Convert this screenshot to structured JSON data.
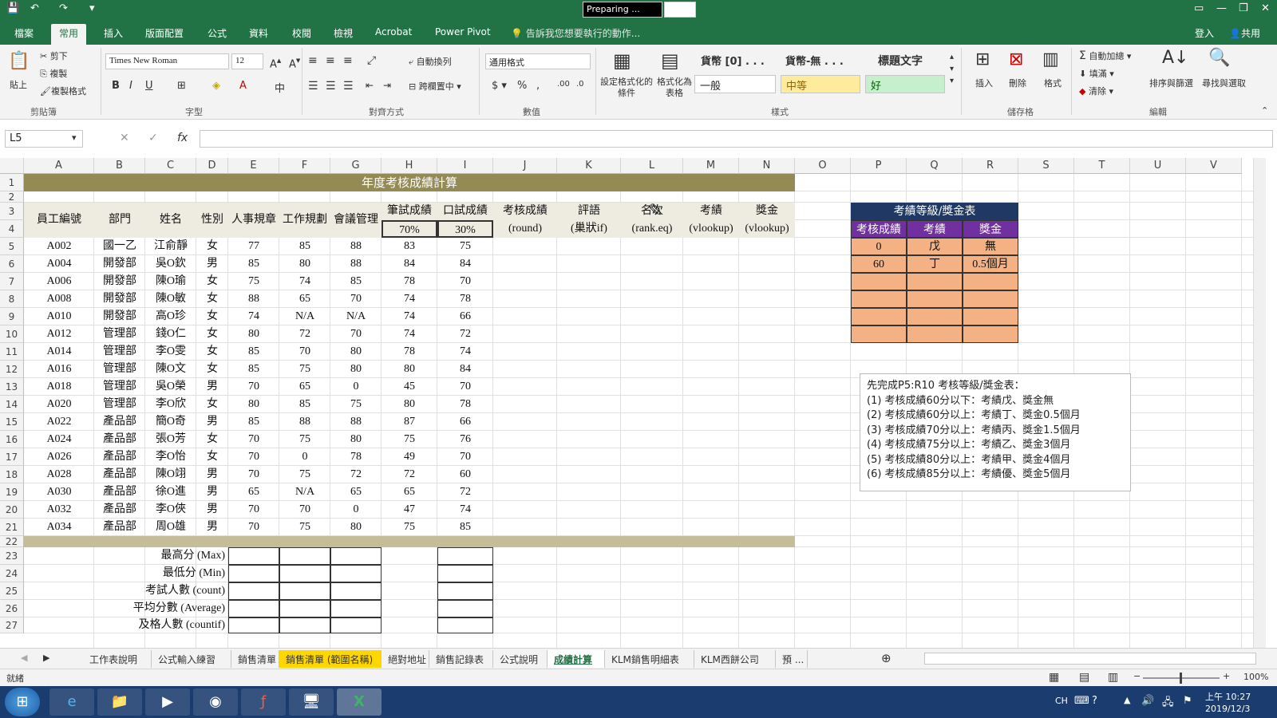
{
  "titlebar": {
    "preparing": "Preparing ..."
  },
  "ribbon_tabs": [
    "檔案",
    "常用",
    "插入",
    "版面配置",
    "公式",
    "資料",
    "校閱",
    "檢視",
    "Acrobat",
    "Power Pivot"
  ],
  "tell_me": "告訴我您想要執行的動作...",
  "account": {
    "login": "登入",
    "share": "共用"
  },
  "ribbon": {
    "cut": "剪下",
    "copy": "複製",
    "paste": "貼上",
    "format_painter": "複製格式",
    "clipboard": "剪貼簿",
    "font_name": "Times New Roman",
    "font_size": "12",
    "font_group": "字型",
    "wrap": "自動換列",
    "merge": "跨欄置中",
    "align_group": "對齊方式",
    "number_format": "通用格式",
    "number_group": "數值",
    "cond_format": "設定格式化的條件",
    "format_table": "格式化為表格",
    "styles": [
      "貨幣 [0] . . .",
      "貨幣-無 . . .",
      "標題文字",
      "一般",
      "中等",
      "好"
    ],
    "styles_group": "樣式",
    "insert": "插入",
    "delete": "刪除",
    "format": "格式",
    "cells_group": "儲存格",
    "autosum": "自動加總",
    "fill": "填滿",
    "clear": "清除",
    "sort": "排序與篩選",
    "find": "尋找與選取",
    "edit_group": "編輯"
  },
  "namebox": "L5",
  "columns": [
    "A",
    "B",
    "C",
    "D",
    "E",
    "F",
    "G",
    "H",
    "I",
    "J",
    "K",
    "L",
    "M",
    "N",
    "O",
    "P",
    "Q",
    "R",
    "S",
    "T",
    "U",
    "V"
  ],
  "rows": [
    "1",
    "2",
    "3",
    "4",
    "5",
    "6",
    "7",
    "8",
    "9",
    "10",
    "11",
    "12",
    "13",
    "14",
    "15",
    "16",
    "17",
    "18",
    "19",
    "20",
    "21",
    "22",
    "23",
    "24",
    "25",
    "26",
    "27"
  ],
  "sheet_title": "年度考核成績計算",
  "headers": {
    "emp": "員工編號",
    "dept": "部門",
    "name": "姓名",
    "gender": "性別",
    "e": "人事規章",
    "f": "工作規劃",
    "g": "會議管理",
    "h": "筆試成績",
    "i": "口試成績",
    "h_pct": "70%",
    "i_pct": "30%",
    "j": "考核成績",
    "j2": "(round)",
    "k": "評語",
    "k2": "(巢狀if)",
    "l": "名次",
    "l2": "(rank.eq)",
    "m": "考績",
    "m2": "(vlookup)",
    "n": "獎金",
    "n2": "(vlookup)"
  },
  "employees": [
    [
      "A002",
      "國一乙",
      "江俞靜",
      "女",
      "77",
      "85",
      "88",
      "83",
      "75"
    ],
    [
      "A004",
      "開發部",
      "吳O欽",
      "男",
      "85",
      "80",
      "88",
      "84",
      "84"
    ],
    [
      "A006",
      "開發部",
      "陳O瑜",
      "女",
      "75",
      "74",
      "85",
      "78",
      "70"
    ],
    [
      "A008",
      "開發部",
      "陳O敏",
      "女",
      "88",
      "65",
      "70",
      "74",
      "78"
    ],
    [
      "A010",
      "開發部",
      "高O珍",
      "女",
      "74",
      "N/A",
      "N/A",
      "74",
      "66"
    ],
    [
      "A012",
      "管理部",
      "錢O仁",
      "女",
      "80",
      "72",
      "70",
      "74",
      "72"
    ],
    [
      "A014",
      "管理部",
      "李O雯",
      "女",
      "85",
      "70",
      "80",
      "78",
      "74"
    ],
    [
      "A016",
      "管理部",
      "陳O文",
      "女",
      "85",
      "75",
      "80",
      "80",
      "84"
    ],
    [
      "A018",
      "管理部",
      "吳O榮",
      "男",
      "70",
      "65",
      "0",
      "45",
      "70"
    ],
    [
      "A020",
      "管理部",
      "李O欣",
      "女",
      "80",
      "85",
      "75",
      "80",
      "78"
    ],
    [
      "A022",
      "產品部",
      "簡O奇",
      "男",
      "85",
      "88",
      "88",
      "87",
      "66"
    ],
    [
      "A024",
      "產品部",
      "張O芳",
      "女",
      "70",
      "75",
      "80",
      "75",
      "76"
    ],
    [
      "A026",
      "產品部",
      "李O怡",
      "女",
      "70",
      "0",
      "78",
      "49",
      "70"
    ],
    [
      "A028",
      "產品部",
      "陳O翊",
      "男",
      "70",
      "75",
      "72",
      "72",
      "60"
    ],
    [
      "A030",
      "產品部",
      "徐O進",
      "男",
      "65",
      "N/A",
      "65",
      "65",
      "72"
    ],
    [
      "A032",
      "產品部",
      "李O俠",
      "男",
      "70",
      "70",
      "0",
      "47",
      "74"
    ],
    [
      "A034",
      "產品部",
      "周O雄",
      "男",
      "70",
      "75",
      "80",
      "75",
      "85"
    ]
  ],
  "stats": [
    "最高分 (Max)",
    "最低分 (Min)",
    "考試人數 (count)",
    "平均分數 (Average)",
    "及格人數 (countif)"
  ],
  "bonus_table": {
    "title": "考績等級/獎金表",
    "headers": [
      "考核成績",
      "考績",
      "獎金"
    ],
    "rows": [
      [
        "0",
        "戊",
        "無"
      ],
      [
        "60",
        "丁",
        "0.5個月"
      ]
    ]
  },
  "notes": [
    "先完成P5:R10 考核等級/獎金表：",
    "(1) 考核成績60分以下：考績戊、獎金無",
    "(2) 考核成績60分以上：考績丁、獎金0.5個月",
    "(3) 考核成績70分以上：考績丙、獎金1.5個月",
    "(4) 考核成績75分以上：考績乙、獎金3個月",
    "(5) 考核成績80分以上：考績甲、獎金4個月",
    "(6) 考核成績85分以上：考績優、獎金5個月"
  ],
  "sheet_tabs": [
    "工作表說明",
    "公式輸入練習",
    "銷售清單",
    "銷售清單 (範圍名稱)",
    "絕對地址",
    "銷售記錄表",
    "公式說明",
    "成績計算",
    "KLM銷售明細表",
    "KLM西餅公司",
    "預 ..."
  ],
  "status": {
    "ready": "就緒",
    "zoom": "100%"
  },
  "clock": {
    "time": "上午 10:27",
    "date": "2019/12/3",
    "lang": "CH"
  },
  "colors": {
    "excel_green": "#217346",
    "title_band": "#948a54",
    "header_band": "#eeece1",
    "bonus_head": "#1f3864",
    "bonus_sub": "#7030a0",
    "bonus_cell": "#f4b183"
  }
}
